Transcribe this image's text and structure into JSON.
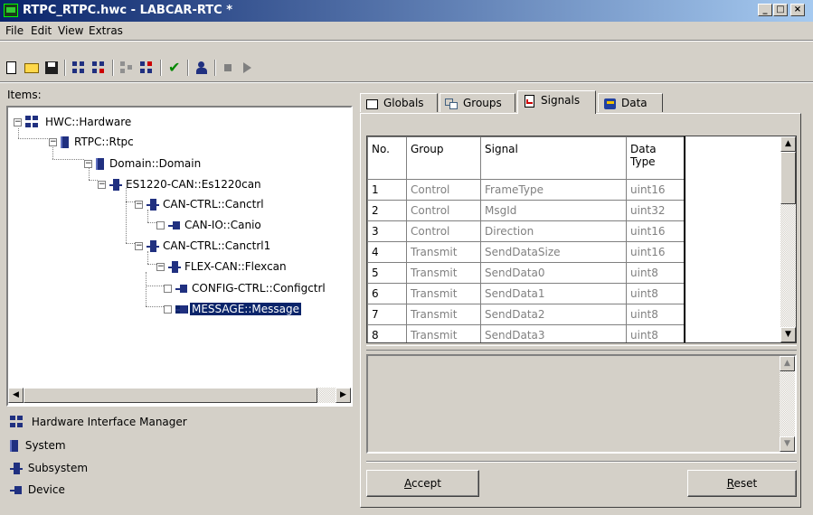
{
  "window": {
    "title": "RTPC_RTPC.hwc - LABCAR-RTC  *"
  },
  "menu": {
    "items": [
      "File",
      "Edit",
      "View",
      "Extras"
    ]
  },
  "toolbar": {
    "tools": [
      "new-icon",
      "open-icon",
      "save-icon",
      "tree-add-icon",
      "tree-remove-icon",
      "tree-disabled-icon",
      "tree-insert-icon",
      "check-icon",
      "user-icon",
      "stop-icon",
      "play-icon"
    ]
  },
  "left": {
    "items_label": "Items:",
    "tree": [
      {
        "label": "HWC::Hardware",
        "icon": "hardware-icon",
        "expanded": true
      },
      {
        "label": "RTPC::Rtpc",
        "icon": "system-icon",
        "expanded": true
      },
      {
        "label": "Domain::Domain",
        "icon": "system-icon",
        "expanded": true
      },
      {
        "label": "ES1220-CAN::Es1220can",
        "icon": "subsystem-icon",
        "expanded": true
      },
      {
        "label": "CAN-CTRL::Canctrl",
        "icon": "subsystem-icon",
        "expanded": true
      },
      {
        "label": "CAN-IO::Canio",
        "icon": "device-icon",
        "expanded": false
      },
      {
        "label": "CAN-CTRL::Canctrl1",
        "icon": "subsystem-icon",
        "expanded": true
      },
      {
        "label": "FLEX-CAN::Flexcan",
        "icon": "subsystem-icon",
        "expanded": true
      },
      {
        "label": "CONFIG-CTRL::Configctrl",
        "icon": "device-icon",
        "expanded": false
      },
      {
        "label": "MESSAGE::Message",
        "icon": "device-icon",
        "expanded": false,
        "selected": true
      }
    ],
    "legend": [
      {
        "label": "Hardware Interface Manager",
        "icon": "hardware-icon"
      },
      {
        "label": "System",
        "icon": "system-icon"
      },
      {
        "label": "Subsystem",
        "icon": "subsystem-icon"
      },
      {
        "label": "Device",
        "icon": "device-icon"
      }
    ]
  },
  "tabs": [
    {
      "label": "Globals",
      "icon": "globals-icon",
      "active": false
    },
    {
      "label": "Groups",
      "icon": "groups-icon",
      "active": false
    },
    {
      "label": "Signals",
      "icon": "signals-icon",
      "active": true
    },
    {
      "label": "Data",
      "icon": "data-icon",
      "active": false
    }
  ],
  "signals": {
    "columns": [
      "No.",
      "Group",
      "Signal",
      "Data Type"
    ],
    "rows": [
      [
        "1",
        "Control",
        "FrameType",
        "uint16"
      ],
      [
        "2",
        "Control",
        "MsgId",
        "uint32"
      ],
      [
        "3",
        "Control",
        "Direction",
        "uint16"
      ],
      [
        "4",
        "Transmit",
        "SendDataSize",
        "uint16"
      ],
      [
        "5",
        "Transmit",
        "SendData0",
        "uint8"
      ],
      [
        "6",
        "Transmit",
        "SendData1",
        "uint8"
      ],
      [
        "7",
        "Transmit",
        "SendData2",
        "uint8"
      ],
      [
        "8",
        "Transmit",
        "SendData3",
        "uint8"
      ]
    ]
  },
  "buttons": {
    "accept": "Accept",
    "accept_mnemonic": "A",
    "accept_rest": "ccept",
    "reset": "Reset",
    "reset_mnemonic": "R",
    "reset_rest": "eset"
  },
  "colors": {
    "selection": "#0a246a",
    "face": "#d4d0c8",
    "icon_blue": "#203080"
  }
}
